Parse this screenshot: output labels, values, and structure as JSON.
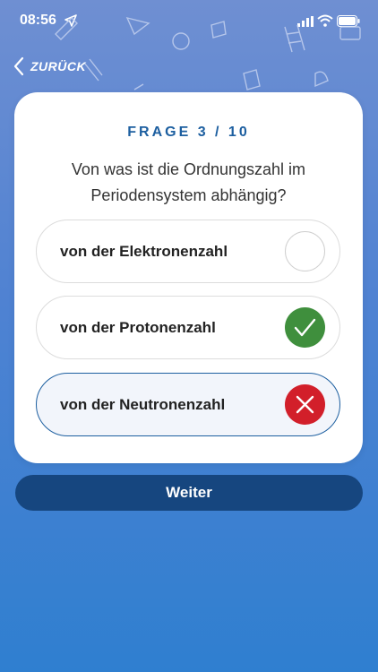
{
  "status_bar": {
    "time": "08:56"
  },
  "nav": {
    "back_label": "ZURÜCK"
  },
  "quiz": {
    "counter": "FRAGE 3 / 10",
    "question": "Von was ist die Ordnungszahl im Periodensystem abhängig?",
    "answers": [
      {
        "label": "von der Elektronenzahl",
        "state": "unselected"
      },
      {
        "label": "von der Protonenzahl",
        "state": "correct"
      },
      {
        "label": "von der Neutronenzahl",
        "state": "wrong-selected"
      }
    ]
  },
  "actions": {
    "next_label": "Weiter"
  },
  "colors": {
    "accent": "#1d5fa0",
    "button": "#16467f",
    "correct": "#3f8f3d",
    "wrong": "#d21f2a"
  },
  "icons": {
    "back": "chevron-left-icon",
    "correct": "checkmark-icon",
    "wrong": "cross-icon"
  }
}
